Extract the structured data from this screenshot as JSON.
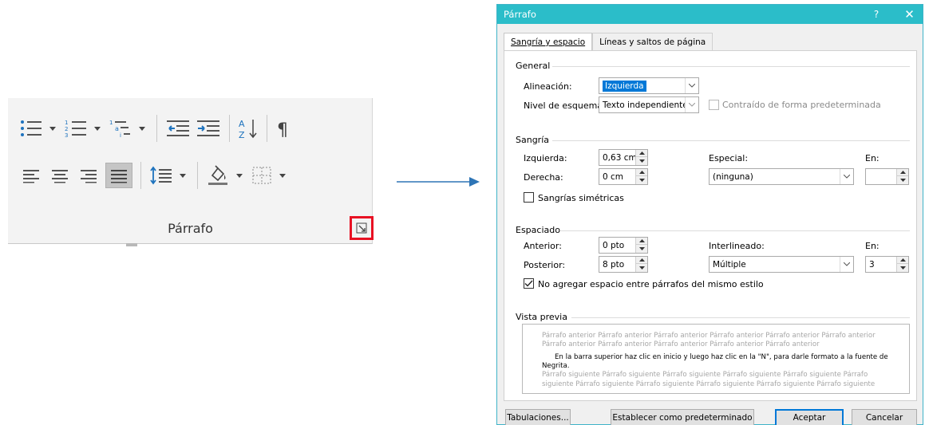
{
  "ribbon": {
    "group_label": "Párrafo",
    "row1_icons": [
      "bullets-icon",
      "numbering-icon",
      "multilevel-list-icon",
      "decrease-indent-icon",
      "increase-indent-icon",
      "sort-icon",
      "show-marks-icon"
    ],
    "row2_icons": [
      "align-left-icon",
      "align-center-icon",
      "align-right-icon",
      "justify-icon",
      "line-spacing-icon",
      "shading-icon",
      "borders-icon"
    ],
    "selected_icon": "justify-icon",
    "launcher_icon": "dialog-launcher-icon",
    "highlight_color": "#e81123"
  },
  "dialog": {
    "title": "Párrafo",
    "help": "?",
    "close": "✕",
    "titlebar_color": "#2bbdc9",
    "tabs": [
      {
        "label": "Sangría y espacio",
        "active": true
      },
      {
        "label": "Líneas y saltos de página",
        "active": false
      }
    ],
    "general": {
      "title": "General",
      "alignment_label": "Alineación:",
      "alignment_value": "Izquierda",
      "outline_label": "Nivel de esquema:",
      "outline_value": "Texto independiente",
      "collapsed_label": "Contraído de forma predeterminada"
    },
    "indent": {
      "title": "Sangría",
      "left_label": "Izquierda:",
      "left_value": "0,63 cm",
      "right_label": "Derecha:",
      "right_value": "0 cm",
      "special_label": "Especial:",
      "special_value": "(ninguna)",
      "by_label": "En:",
      "by_value": "",
      "mirror_label": "Sangrías simétricas"
    },
    "spacing": {
      "title": "Espaciado",
      "before_label": "Anterior:",
      "before_value": "0 pto",
      "after_label": "Posterior:",
      "after_value": "8 pto",
      "line_label": "Interlineado:",
      "line_value": "Múltiple",
      "at_label": "En:",
      "at_value": "3",
      "no_space_label": "No agregar espacio entre párrafos del mismo estilo",
      "no_space_checked": true
    },
    "preview": {
      "title": "Vista previa",
      "prev_1": "Párrafo anterior Párrafo anterior Párrafo anterior Párrafo anterior Párrafo anterior Párrafo anterior",
      "prev_2": "Párrafo anterior Párrafo anterior Párrafo anterior Párrafo anterior Párrafo anterior",
      "main_1": "En la barra superior haz clic en inicio y luego haz clic en la \"N\", para darle formato a la fuente de",
      "main_2": "Negrita.",
      "next_1": "Párrafo siguiente Párrafo siguiente Párrafo siguiente Párrafo siguiente Párrafo siguiente Párrafo",
      "next_2": "siguiente Párrafo siguiente Párrafo siguiente Párrafo siguiente Párrafo siguiente Párrafo siguiente"
    },
    "buttons": {
      "tabs": "Tabulaciones...",
      "default": "Establecer como predeterminado",
      "ok": "Aceptar",
      "cancel": "Cancelar"
    }
  }
}
